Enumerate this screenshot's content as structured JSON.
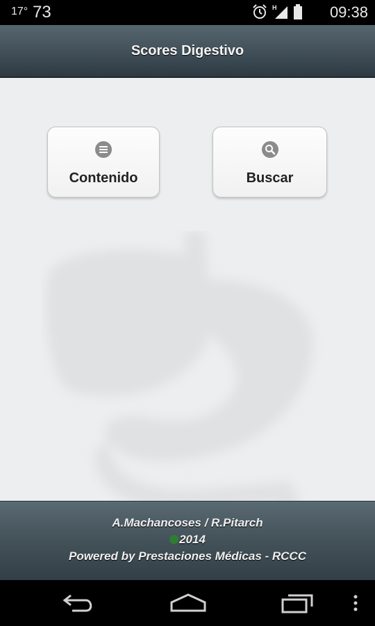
{
  "status_bar": {
    "temperature": "17°",
    "signal_value": "73",
    "time": "09:38",
    "icons": [
      "alarm-icon",
      "signal-icon",
      "battery-icon"
    ]
  },
  "header": {
    "title": "Scores Digestivo"
  },
  "tiles": [
    {
      "label": "Contenido",
      "icon": "list-icon"
    },
    {
      "label": "Buscar",
      "icon": "search-icon"
    }
  ],
  "background_image": "stomach-liver-watermark",
  "footer": {
    "authors": "A.Machancoses / R.Pitarch",
    "year": "2014",
    "powered_by": "Powered by Prestaciones Médicas - RCCC"
  },
  "nav_bar": {
    "buttons": [
      "back-icon",
      "home-icon",
      "recent-apps-icon",
      "menu-icon"
    ]
  },
  "colors": {
    "header_bg": "#404e57",
    "content_bg": "#eceeef",
    "icon_grey": "#8b8b8b",
    "copyright_green": "#2f7d33"
  }
}
